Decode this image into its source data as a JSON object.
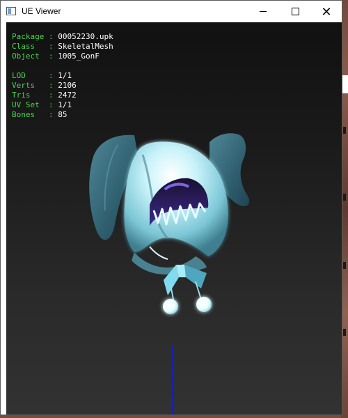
{
  "window": {
    "title": "UE Viewer",
    "controls": {
      "minimize": "minimize",
      "maximize": "maximize",
      "close": "close"
    }
  },
  "info_panel": {
    "rows": [
      {
        "key": "Package",
        "sep": " : ",
        "value": "00052230.upk"
      },
      {
        "key": "Class  ",
        "sep": " : ",
        "value": "SkeletalMesh"
      },
      {
        "key": "Object ",
        "sep": " : ",
        "value": "1005_GonF"
      }
    ],
    "stats": [
      {
        "key": "LOD    ",
        "sep": " : ",
        "value": "1/1"
      },
      {
        "key": "Verts  ",
        "sep": " : ",
        "value": "2106"
      },
      {
        "key": "Tris   ",
        "sep": " : ",
        "value": "2472"
      },
      {
        "key": "UV Set ",
        "sep": " : ",
        "value": "1/1"
      },
      {
        "key": "Bones  ",
        "sep": " : ",
        "value": "85"
      }
    ]
  },
  "colors": {
    "label_green": "#44d64a",
    "axis_blue": "#1621a8",
    "mesh_cyan": "#9fe6f0",
    "mesh_teal": "#3d6f80",
    "mesh_purple": "#5a3fc2"
  },
  "icons": {
    "app": "window-app-icon",
    "minimize": "minimize-icon",
    "maximize": "maximize-icon",
    "close": "close-icon"
  }
}
